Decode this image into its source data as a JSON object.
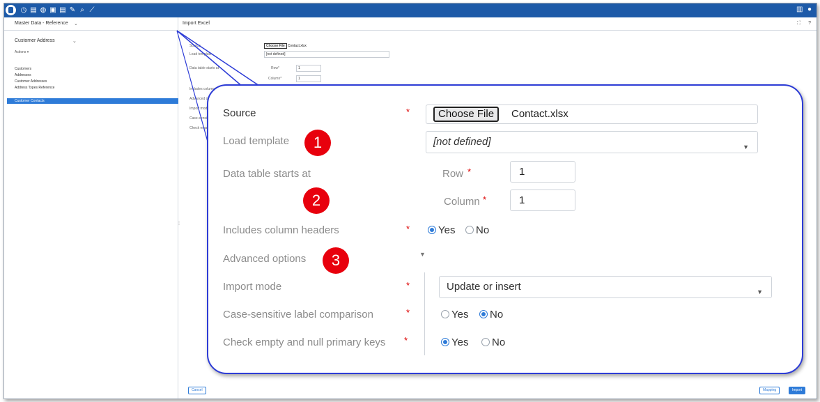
{
  "toolbar": {
    "icons": [
      "app-logo",
      "clock-icon",
      "document-icon",
      "gauge-icon",
      "data-icon",
      "document2-icon",
      "pin-icon",
      "search-icon",
      "wand-icon"
    ],
    "right_icons": [
      "grid-icon",
      "user-icon"
    ]
  },
  "leftnav": {
    "header": "Master Data - Reference",
    "header_chevron": "⌄",
    "title": "Customer Address",
    "title_chevron": "⌄",
    "actions": "Actions ▾",
    "items": [
      "Customers",
      "Addresses",
      "Customer Addresses",
      "Address Types Reference",
      "Customer Contacts"
    ],
    "splitter": "⋮"
  },
  "main": {
    "title": "Import Excel",
    "icon_expand": "⛶",
    "icon_help": "?",
    "mini": {
      "source_label": "Source",
      "load_label": "Load template",
      "data_label": "Data table starts at",
      "row_label": "Row*",
      "column_label": "Column*",
      "includes_label": "Includes column headers",
      "advanced_label": "Advanced options",
      "import_label": "Import mode",
      "case_label": "Case-sensitive label comparison",
      "check_label": "Check empty and null primary keys",
      "choose": "Choose File",
      "file": "Contact.xlsx",
      "template": "[not defined]",
      "row": "1",
      "column": "1"
    },
    "buttons": {
      "cancel": "Cancel",
      "mapping": "Mapping",
      "import": "Import"
    }
  },
  "zoom": {
    "source_label": "Source",
    "required_mark": "*",
    "choose_file": "Choose File",
    "file_name": "Contact.xlsx",
    "load_template_label": "Load template",
    "load_template_value": "[not defined]",
    "data_table_label": "Data table starts at",
    "row_label": "Row",
    "row_value": "1",
    "column_label": "Column",
    "column_value": "1",
    "includes_headers_label": "Includes column headers",
    "yes": "Yes",
    "no": "No",
    "advanced_label": "Advanced options",
    "import_mode_label": "Import mode",
    "import_mode_value": "Update or insert",
    "case_label": "Case-sensitive label comparison",
    "check_label": "Check empty and null primary keys",
    "badges": [
      "1",
      "2",
      "3"
    ],
    "selection": {
      "includes_headers": "Yes",
      "case_sensitive": "No",
      "check_empty": "Yes"
    }
  }
}
